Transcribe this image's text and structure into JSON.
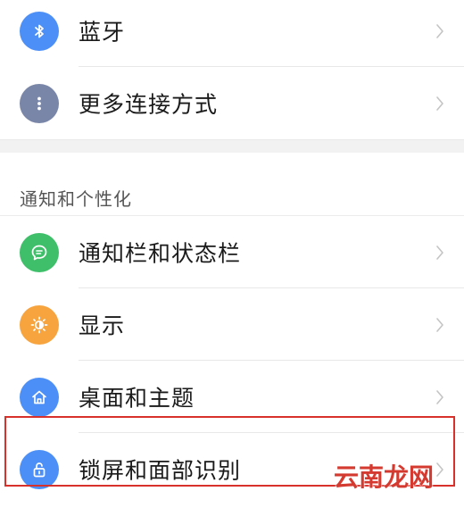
{
  "connections": {
    "bluetooth": {
      "label": "蓝牙",
      "icon": "bluetooth-icon",
      "color": "#4c8ff6"
    },
    "more": {
      "label": "更多连接方式",
      "icon": "more-dots-icon",
      "color": "#7a86a8"
    }
  },
  "section": {
    "title": "通知和个性化",
    "items": [
      {
        "label": "通知栏和状态栏",
        "icon": "message-bubble-icon",
        "color": "#3fbf6a"
      },
      {
        "label": "显示",
        "icon": "brightness-icon",
        "color": "#f7a43e"
      },
      {
        "label": "桌面和主题",
        "icon": "home-icon",
        "color": "#4c8ff6"
      },
      {
        "label": "锁屏和面部识别",
        "icon": "unlock-icon",
        "color": "#4c8ff6"
      }
    ]
  },
  "watermark": "云南龙网"
}
